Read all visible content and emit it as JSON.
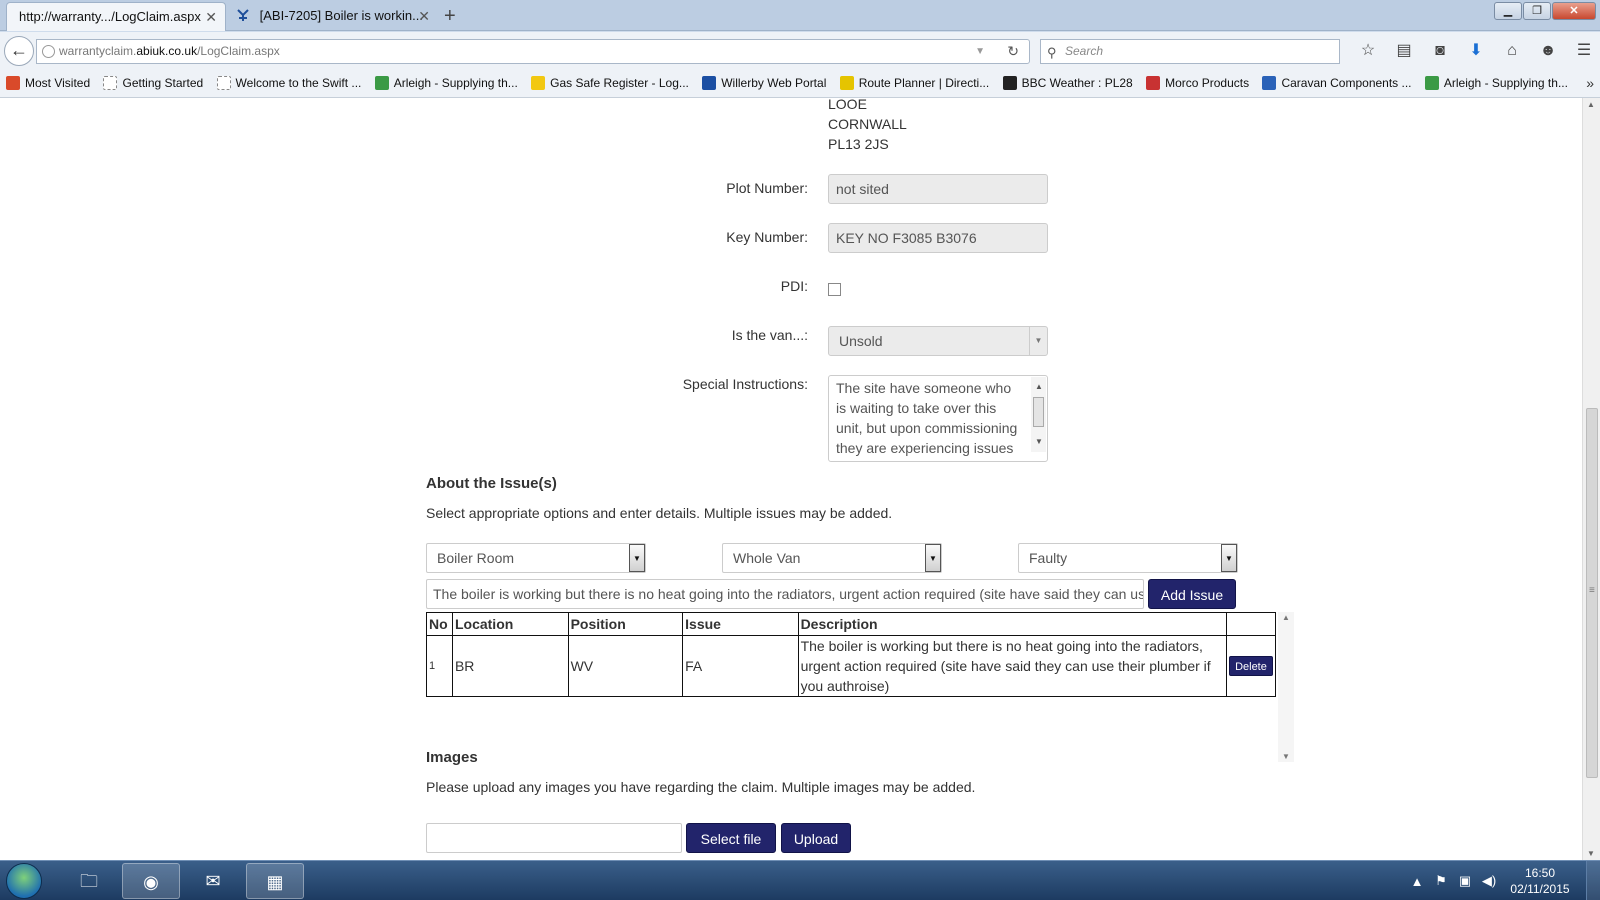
{
  "browser": {
    "tabs": [
      {
        "label": "http://warranty.../LogClaim.aspx",
        "active": true
      },
      {
        "label": "[ABI-7205] Boiler is workin...",
        "active": false
      }
    ],
    "url_prefix": "warrantyclaim.",
    "url_domain": "abiuk.co.uk",
    "url_path": "/LogClaim.aspx",
    "search_placeholder": "Search",
    "bookmarks": [
      {
        "label": "Most Visited",
        "color": "#d94a2a"
      },
      {
        "label": "Getting Started",
        "color": "#cfd6df"
      },
      {
        "label": "Welcome to the Swift ...",
        "color": "#cfd6df"
      },
      {
        "label": "Arleigh - Supplying th...",
        "color": "#3b9a45"
      },
      {
        "label": "Gas Safe Register - Log...",
        "color": "#f2c811"
      },
      {
        "label": "Willerby Web Portal",
        "color": "#1b4fa3"
      },
      {
        "label": "Route Planner | Directi...",
        "color": "#e5c400"
      },
      {
        "label": "BBC Weather : PL28",
        "color": "#222222"
      },
      {
        "label": "Morco Products",
        "color": "#c83232"
      },
      {
        "label": "Caravan Components ...",
        "color": "#2a62b8"
      },
      {
        "label": "Arleigh - Supplying th...",
        "color": "#3b9a45"
      }
    ]
  },
  "address": {
    "line1": "LOOE",
    "line2": "CORNWALL",
    "line3": "PL13 2JS"
  },
  "form": {
    "plot_label": "Plot Number:",
    "plot_value": "not sited",
    "key_label": "Key Number:",
    "key_value": "KEY NO F3085 B3076",
    "pdi_label": "PDI:",
    "pdi_checked": false,
    "van_label": "Is the van...:",
    "van_value": "Unsold",
    "special_label": "Special Instructions:",
    "special_value": "The site have someone who is waiting to take over this unit, but upon commissioning they are experiencing issues"
  },
  "issues": {
    "title": "About the Issue(s)",
    "instructions": "Select appropriate options and enter details. Multiple issues may be added.",
    "location_select": "Boiler Room",
    "position_select": "Whole Van",
    "issue_select": "Faulty",
    "description_value": "The boiler is working but there is no heat going into the radiators, urgent action required (site have said they can use their plumber if you authroise)",
    "add_button": "Add Issue",
    "table_headers": [
      "No",
      "Location",
      "Position",
      "Issue",
      "Description",
      ""
    ],
    "rows": [
      {
        "no": "1",
        "location": "BR",
        "position": "WV",
        "issue": "FA",
        "description": "The boiler is working but there is no heat going into the radiators, urgent action required (site have said they can use their plumber if you authroise)",
        "delete_label": "Delete"
      }
    ]
  },
  "images": {
    "title": "Images",
    "instructions": "Please upload any images you have regarding the claim. Multiple images may be added.",
    "select_button": "Select file",
    "upload_button": "Upload"
  },
  "taskbar": {
    "time": "16:50",
    "date": "02/11/2015"
  }
}
